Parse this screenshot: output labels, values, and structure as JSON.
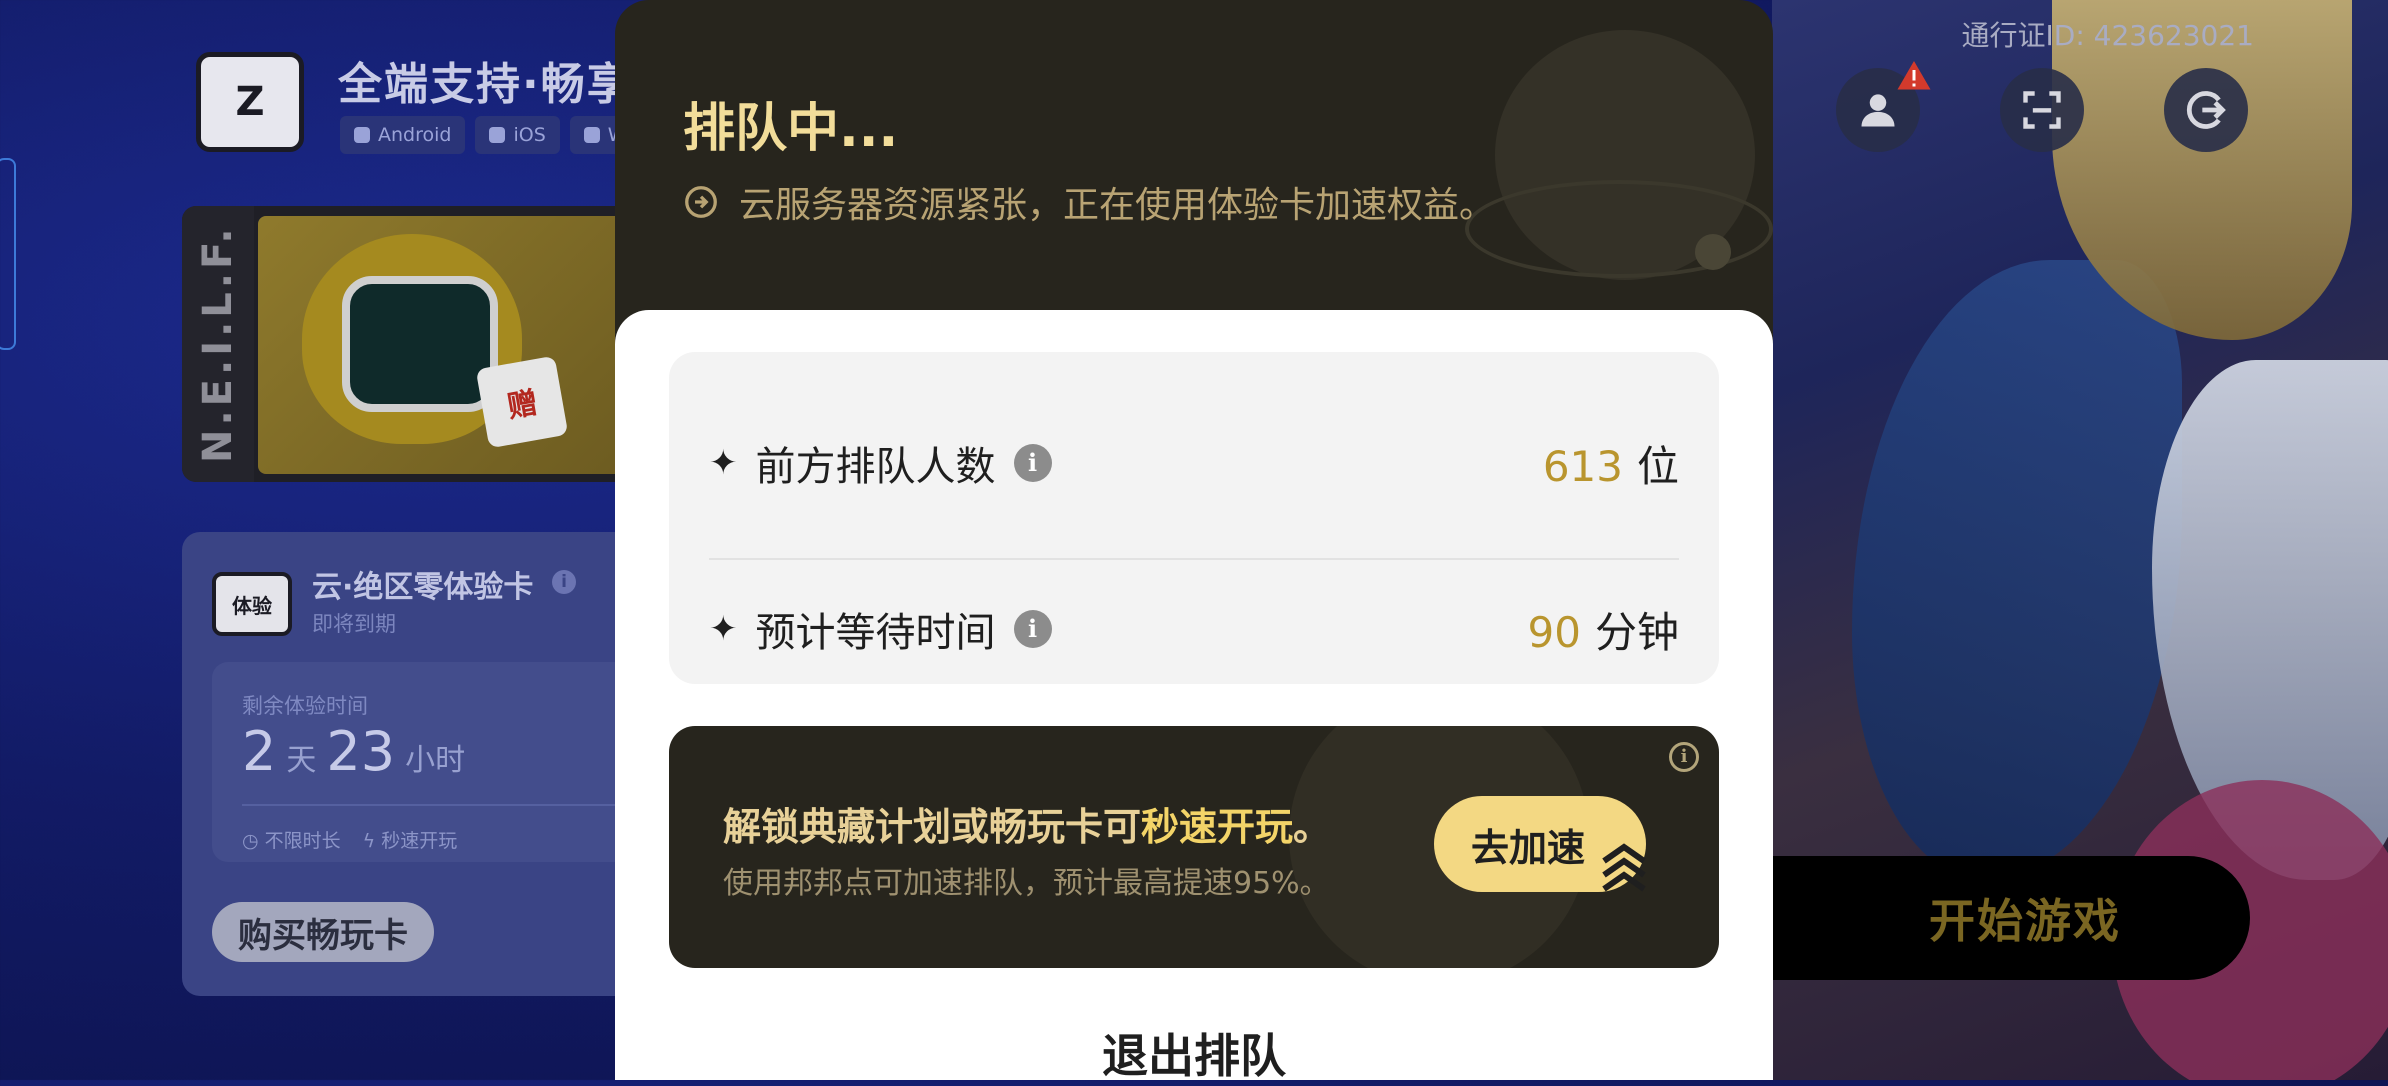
{
  "left_page": {
    "brand_title": "全端支持·畅享",
    "brand_logo_glyph": "Z",
    "platforms": [
      "Android",
      "iOS",
      "W"
    ],
    "banner": {
      "strip_text": "N.E.I.L.F.",
      "gift_label": "赠"
    },
    "trial_card": {
      "icon_label": "体验",
      "title": "云·绝区零体验卡",
      "info_glyph": "i",
      "subtitle": "即将到期",
      "remaining_label": "剩余体验时间",
      "days_value": "2",
      "days_unit": "天",
      "hours_value": "23",
      "hours_unit": "小时",
      "perks": [
        "不限时长",
        "秒速开玩"
      ],
      "buy_button": "购买畅玩卡"
    }
  },
  "header": {
    "passport_id": "通行证ID: 423623021",
    "icons": [
      "user-icon",
      "scan-icon",
      "logout-icon"
    ]
  },
  "start_button": "开始游戏",
  "modal": {
    "title": "排队中...",
    "subtitle": "云服务器资源紧张，正在使用体验卡加速权益。",
    "stats": [
      {
        "label": "前方排队人数",
        "value": "613",
        "unit": "位"
      },
      {
        "label": "预计等待时间",
        "value": "90",
        "unit": "分钟"
      }
    ],
    "info_glyph": "i",
    "promo": {
      "main_prefix": "解锁典藏计划或畅玩卡可",
      "main_highlight": "秒速开玩",
      "main_suffix": "。",
      "sub": "使用邦邦点可加速排队，预计最高提速95%。",
      "button": "去加速"
    },
    "exit_button": "退出排队"
  },
  "colors": {
    "modal_dark": "#27251d",
    "gold_text": "#f2dd9a",
    "value_gold": "#b9952e",
    "speed_button": "#f3d883",
    "page_bg": "#121b66"
  }
}
